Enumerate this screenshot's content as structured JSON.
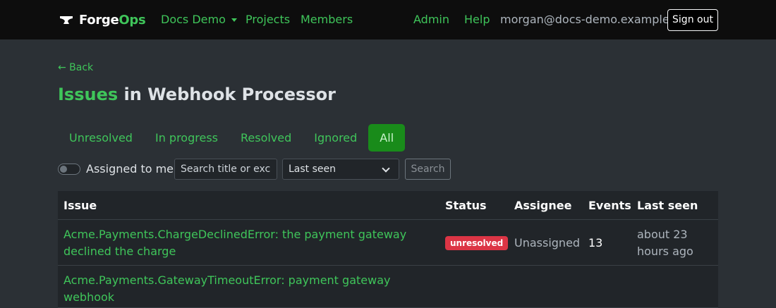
{
  "nav": {
    "brand_a": "Forge",
    "brand_b": "Ops",
    "org": "Docs Demo",
    "projects": "Projects",
    "members": "Members",
    "admin": "Admin",
    "help": "Help",
    "user_email": "morgan@docs-demo.example",
    "signout": "Sign out"
  },
  "page": {
    "back": "← Back",
    "title_highlight": "Issues",
    "title_rest": " in Webhook Processor"
  },
  "tabs": [
    {
      "label": "Unresolved",
      "active": false
    },
    {
      "label": "In progress",
      "active": false
    },
    {
      "label": "Resolved",
      "active": false
    },
    {
      "label": "Ignored",
      "active": false
    },
    {
      "label": "All",
      "active": true
    }
  ],
  "filters": {
    "assigned_label": "Assigned to me",
    "assigned_on": false,
    "search_placeholder": "Search title or exce",
    "search_value": "",
    "sort_selected": "Last seen",
    "search_button": "Search"
  },
  "table": {
    "columns": [
      "Issue",
      "Status",
      "Assignee",
      "Events",
      "Last seen"
    ],
    "rows": [
      {
        "title": "Acme.Payments.ChargeDeclinedError: the payment gateway declined the charge",
        "status": "unresolved",
        "assignee": "Unassigned",
        "events": "13",
        "last_seen": "about 23 hours ago"
      },
      {
        "title": "Acme.Payments.GatewayTimeoutError: payment gateway webhook",
        "status": "",
        "assignee": "",
        "events": "",
        "last_seen": ""
      }
    ]
  },
  "colors": {
    "accent": "#3fc55a",
    "active_tab": "#198b1a",
    "danger": "#dc3545",
    "navbar": "#0d0d0d",
    "page_bg": "#2b3035"
  }
}
